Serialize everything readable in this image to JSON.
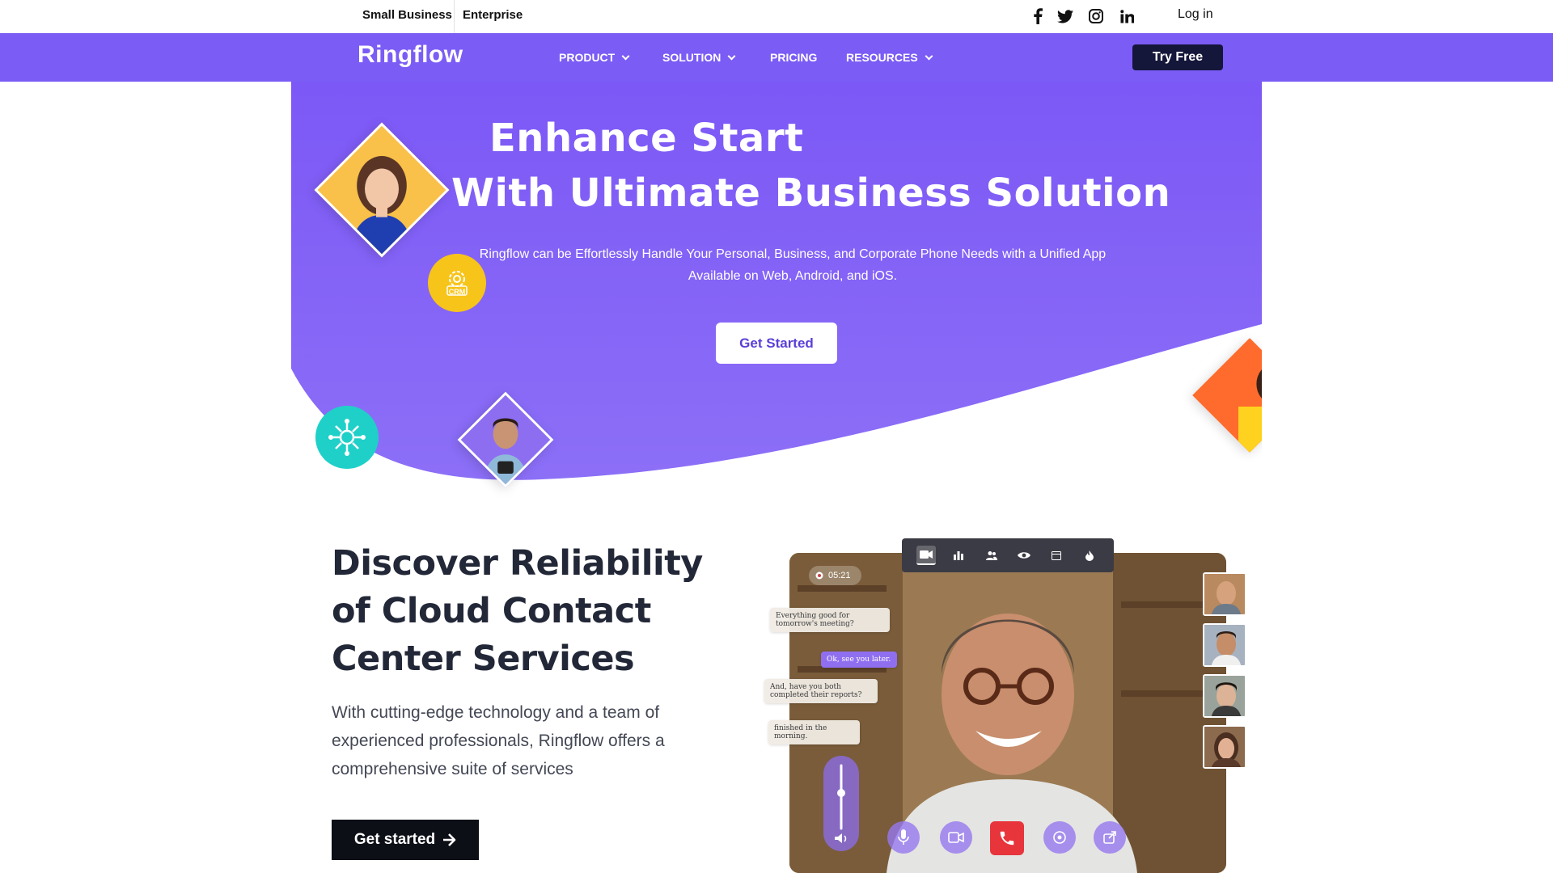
{
  "topbar": {
    "tabs": [
      "Small Business",
      "Enterprise"
    ],
    "social_icons": [
      "facebook-icon",
      "twitter-icon",
      "instagram-icon",
      "linkedin-icon"
    ],
    "login_label": "Log in"
  },
  "navbar": {
    "logo": "Ringflow",
    "items": [
      {
        "label": "PRODUCT",
        "dropdown": true
      },
      {
        "label": "SOLUTION",
        "dropdown": true
      },
      {
        "label": "PRICING",
        "dropdown": false
      },
      {
        "label": "RESOURCES",
        "dropdown": true
      }
    ],
    "cta_label": "Try Free"
  },
  "hero": {
    "title_line1": "Enhance Start",
    "title_line2": "With Ultimate Business Solution",
    "subtitle": "Ringflow can be Effortlessly Handle Your Personal, Business, and Corporate Phone Needs with a Unified App Available on Web, Android, and iOS.",
    "cta_label": "Get Started",
    "crm_badge": "CRM"
  },
  "section": {
    "title": "Discover Reliability of Cloud Contact Center Services",
    "body": "With cutting-edge technology and a team of experienced professionals, Ringflow offers a comprehensive suite of services",
    "cta_label": "Get started"
  },
  "video_call": {
    "timer": "05:21",
    "messages": [
      {
        "text": "Everything good for tomorrow's meeting?",
        "from": "them"
      },
      {
        "text": "Ok, see you later.",
        "from": "me"
      },
      {
        "text": "And, have you both completed their reports?",
        "from": "them"
      },
      {
        "text": "finished in the morning.",
        "from": "them"
      }
    ],
    "toolbar_icons": [
      "video-icon",
      "bar-chart-icon",
      "users-icon",
      "eye-icon",
      "calendar-icon",
      "fire-icon"
    ],
    "controls": [
      "microphone-icon",
      "camera-icon",
      "end-call-icon",
      "screen-share-icon",
      "share-icon"
    ]
  },
  "colors": {
    "brand_purple": "#7b5cf5",
    "dark_navy": "#14163a",
    "end_call_red": "#e8353c",
    "crm_yellow": "#f7c41a",
    "teal": "#1fd0c8"
  }
}
